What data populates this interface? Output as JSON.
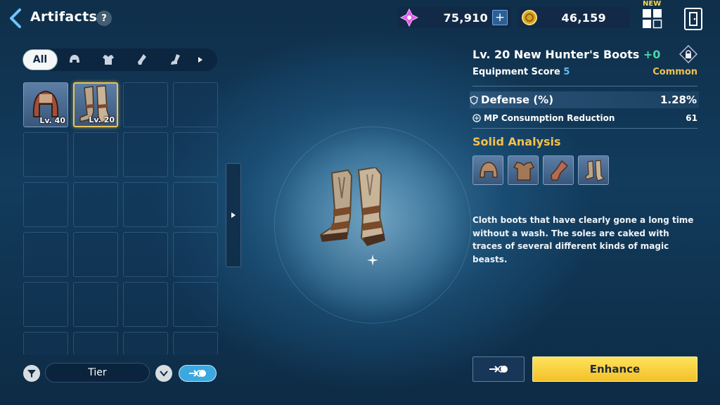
{
  "header": {
    "title": "Artifacts",
    "help_label": "?",
    "gem_value": "75,910",
    "plus_label": "+",
    "gold_value": "46,159",
    "new_badge": "NEW"
  },
  "filter": {
    "all_label": "All",
    "categories": [
      "helmet-icon",
      "armor-icon",
      "gloves-icon",
      "boots-icon"
    ]
  },
  "inventory": {
    "items": [
      {
        "icon": "helmet-icon",
        "level": "Lv. 40",
        "selected": false
      },
      {
        "icon": "boots-icon",
        "level": "Lv. 20",
        "selected": true
      }
    ],
    "rows": 6,
    "cols": 4
  },
  "controls": {
    "sort_label": "Tier"
  },
  "detail": {
    "level": "Lv. 20",
    "name": "New Hunter's Boots",
    "plus": "+0",
    "score_label": "Equipment Score",
    "score_value": "5",
    "rarity": "Common",
    "main_stat_label": "Defense (%)",
    "main_stat_value": "1.28%",
    "sub_stat_label": "MP Consumption Reduction",
    "sub_stat_value": "61",
    "analysis_title": "Solid Analysis",
    "analysis_icons": [
      "helmet-icon",
      "armor-icon",
      "gloves-icon",
      "boots-icon"
    ],
    "description": "Cloth boots that have clearly gone a long time without a wash. The soles are caked with traces of several different kinds of magic beasts."
  },
  "actions": {
    "enhance_label": "Enhance"
  },
  "colors": {
    "accent_gold": "#f2c14e",
    "accent_green": "#48d6a9",
    "enhance_yellow": "#f2c12a",
    "score_blue": "#6bb8f0"
  }
}
